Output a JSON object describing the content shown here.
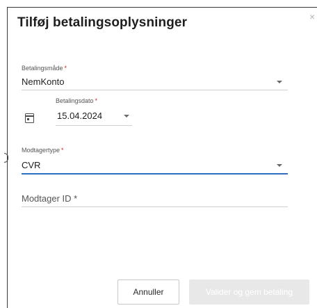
{
  "dialog": {
    "title": "Tilføj betalingsoplysninger",
    "close_glyph": "×"
  },
  "form": {
    "payment_method": {
      "label": "Betalingsmåde",
      "required_mark": "*",
      "value": "NemKonto"
    },
    "payment_date": {
      "label": "Betalingsdato",
      "required_mark": "*",
      "value": "15.04.2024"
    },
    "recipient_type": {
      "label": "Modtagertype",
      "required_mark": "*",
      "value": "CVR"
    },
    "recipient_id": {
      "placeholder": "Modtager ID *"
    }
  },
  "actions": {
    "cancel_label": "Annuller",
    "save_label": "Valider og gem betaling"
  },
  "colors": {
    "focus_underline": "#2d6dc5",
    "required_star": "#d42424",
    "disabled_button_bg": "#e8e8e8"
  },
  "icons": [
    "calendar-icon",
    "chevron-down-icon",
    "close-icon"
  ]
}
